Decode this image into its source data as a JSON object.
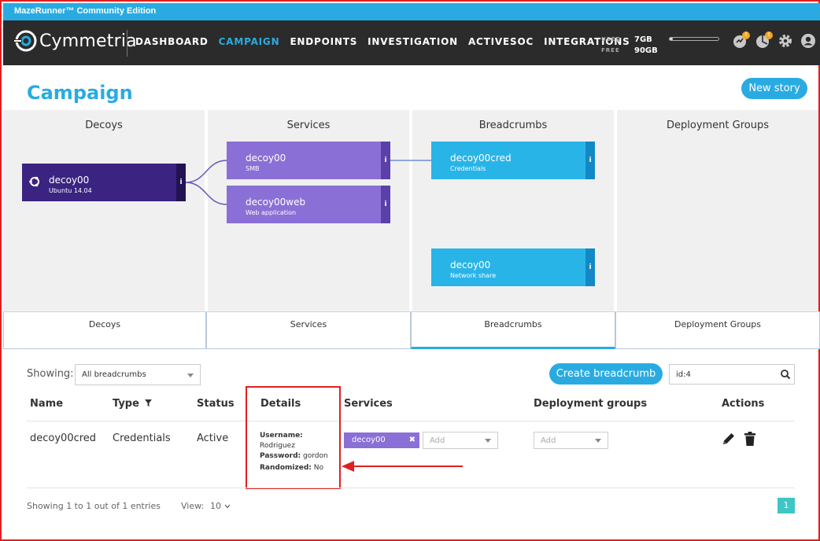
{
  "window": {
    "title": "MazeRunner™ Community Edition"
  },
  "header": {
    "logo_text": "Cymmetria",
    "nav": [
      {
        "label": "DASHBOARD",
        "active": false
      },
      {
        "label": "CAMPAIGN",
        "active": true
      },
      {
        "label": "ENDPOINTS",
        "active": false
      },
      {
        "label": "INVESTIGATION",
        "active": false
      },
      {
        "label": "ACTIVESOC",
        "active": false
      },
      {
        "label": "INTEGRATIONS",
        "active": false
      }
    ],
    "storage": {
      "used_label": "USED",
      "used_value": "7GB",
      "free_label": "FREE",
      "free_value": "90GB",
      "used_fraction": 0.07
    },
    "icons": [
      {
        "name": "alerts-icon",
        "badge": "!"
      },
      {
        "name": "notifications-icon",
        "badge": "!"
      },
      {
        "name": "settings-icon"
      },
      {
        "name": "user-icon"
      }
    ]
  },
  "page": {
    "title": "Campaign",
    "new_story_label": "New story"
  },
  "columns": {
    "decoys": {
      "title": "Decoys",
      "tab": "Decoys"
    },
    "services": {
      "title": "Services",
      "tab": "Services"
    },
    "breadcrumbs": {
      "title": "Breadcrumbs",
      "tab": "Breadcrumbs"
    },
    "deployment_groups": {
      "title": "Deployment Groups",
      "tab": "Deployment Groups"
    }
  },
  "nodes": {
    "decoy": {
      "name": "decoy00",
      "sub": "Ubuntu 14.04",
      "info": "i"
    },
    "service1": {
      "name": "decoy00",
      "sub": "SMB",
      "info": "i"
    },
    "service2": {
      "name": "decoy00web",
      "sub": "Web application",
      "info": "i"
    },
    "crumb1": {
      "name": "decoy00cred",
      "sub": "Credentials",
      "info": "i"
    },
    "crumb2": {
      "name": "decoy00",
      "sub": "Network share",
      "info": "i"
    }
  },
  "table": {
    "showing_label": "Showing:",
    "filter_value": "All breadcrumbs",
    "create_label": "Create breadcrumb",
    "search_value": "id:4",
    "headers": {
      "name": "Name",
      "type": "Type",
      "status": "Status",
      "details": "Details",
      "services": "Services",
      "deployment_groups": "Deployment groups",
      "actions": "Actions"
    },
    "row": {
      "name": "decoy00cred",
      "type": "Credentials",
      "status": "Active",
      "username_label": "Username:",
      "username": "Rodriguez",
      "password_label": "Password:",
      "password": "gordon",
      "randomized_label": "Randomized:",
      "randomized": "No",
      "service_chip": "decoy00",
      "service_chip_remove": "✖",
      "services_add": "Add",
      "groups_add": "Add"
    }
  },
  "footer": {
    "entries": "Showing 1 to 1 out of 1 entries",
    "view_label": "View:",
    "view_value": "10",
    "page": "1"
  },
  "colors": {
    "accent": "#29abe2",
    "decoy": "#3a2381",
    "service": "#8a6fd6",
    "crumb": "#29b4e8",
    "annotation": "#e02020"
  }
}
